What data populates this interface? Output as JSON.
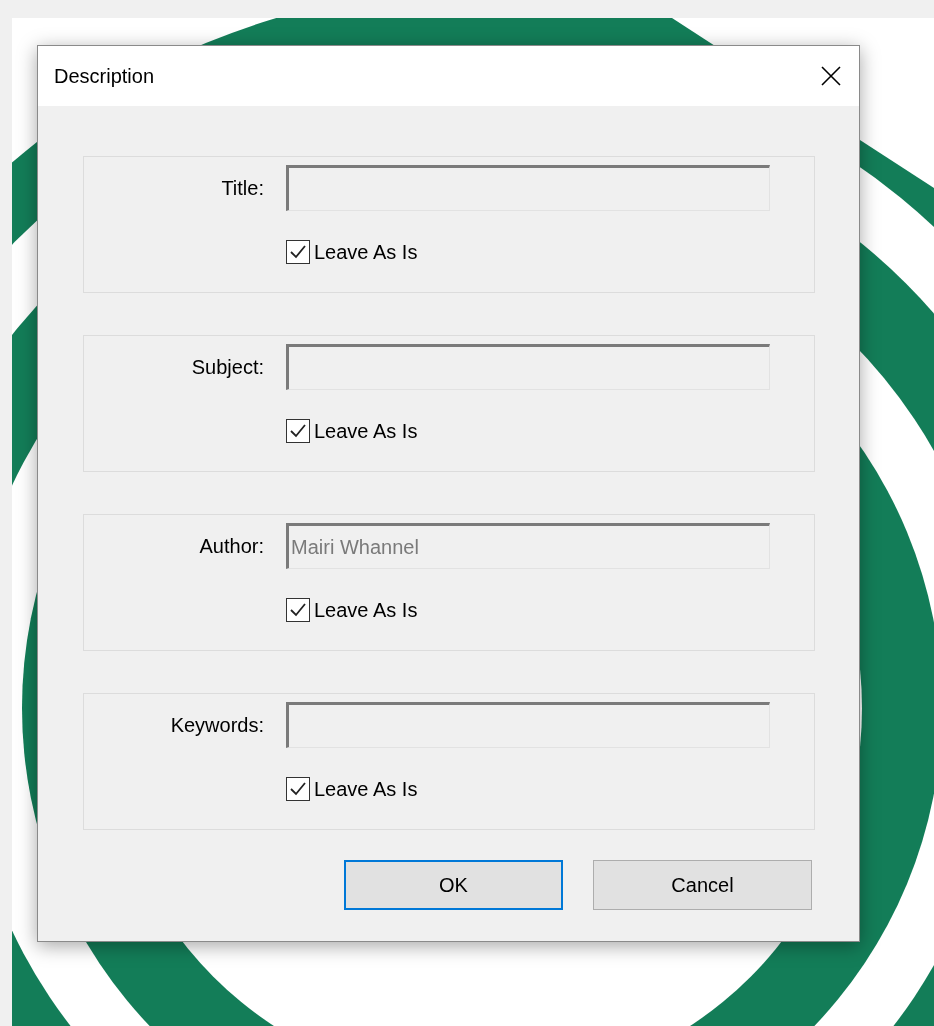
{
  "window": {
    "title": "Description"
  },
  "groups": [
    {
      "label": "Title:",
      "disabled": true,
      "checkbox": {
        "label": "Leave As Is",
        "checked": true
      }
    },
    {
      "label": "Subject:",
      "disabled": true,
      "checkbox": {
        "label": "Leave As Is",
        "checked": true
      }
    },
    {
      "label": "Author:",
      "value": "Mairi Whannel",
      "disabled": true,
      "checkbox": {
        "label": "Leave As Is",
        "checked": true
      }
    },
    {
      "label": "Keywords:",
      "disabled": true,
      "checkbox": {
        "label": "Leave As Is",
        "checked": true
      }
    }
  ],
  "buttons": [
    {
      "label": "OK",
      "focused": true
    },
    {
      "label": "Cancel",
      "focused": false
    }
  ]
}
